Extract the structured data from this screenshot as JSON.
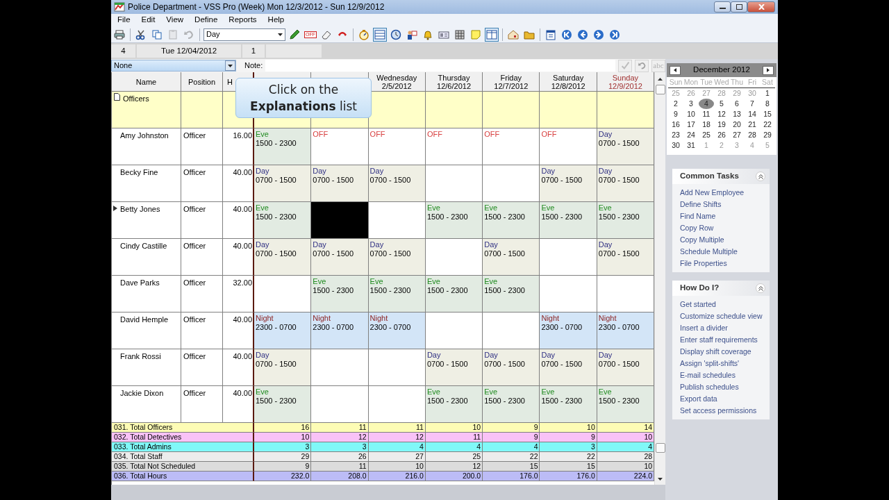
{
  "window": {
    "title": "Police Department - VSS Pro (Week) Mon 12/3/2012 - Sun 12/9/2012"
  },
  "menu": [
    "File",
    "Edit",
    "View",
    "Define",
    "Reports",
    "Help"
  ],
  "toolbar": [
    {
      "kind": "printer",
      "active": false,
      "disabled": false
    },
    {
      "kind": "separator"
    },
    {
      "kind": "scissors",
      "active": false,
      "disabled": false
    },
    {
      "kind": "copy",
      "active": false,
      "disabled": false
    },
    {
      "kind": "paste",
      "active": false,
      "disabled": true
    },
    {
      "kind": "undo",
      "active": false,
      "disabled": true
    },
    {
      "kind": "separator"
    },
    {
      "kind": "select",
      "value": "Day"
    },
    {
      "kind": "pencil",
      "active": false,
      "disabled": false
    },
    {
      "kind": "off",
      "label": "OFF",
      "active": false,
      "disabled": false
    },
    {
      "kind": "eraser",
      "active": false,
      "disabled": false
    },
    {
      "kind": "phone",
      "active": false,
      "disabled": false
    },
    {
      "kind": "separator"
    },
    {
      "kind": "stopwatch",
      "active": false,
      "disabled": false
    },
    {
      "kind": "rows",
      "active": true,
      "disabled": false
    },
    {
      "kind": "clock",
      "active": false,
      "disabled": false
    },
    {
      "kind": "people",
      "active": false,
      "disabled": false
    },
    {
      "kind": "bell",
      "active": false,
      "disabled": false
    },
    {
      "kind": "card",
      "active": false,
      "disabled": false
    },
    {
      "kind": "grid",
      "active": false,
      "disabled": false
    },
    {
      "kind": "note",
      "active": false,
      "disabled": false
    },
    {
      "kind": "panes",
      "active": true,
      "disabled": false
    },
    {
      "kind": "separator"
    },
    {
      "kind": "house",
      "active": false,
      "disabled": false
    },
    {
      "kind": "folder",
      "active": false,
      "disabled": false
    },
    {
      "kind": "separator"
    },
    {
      "kind": "calendar",
      "active": false,
      "disabled": false
    },
    {
      "kind": "first",
      "active": false,
      "disabled": false
    },
    {
      "kind": "prev",
      "active": false,
      "disabled": false
    },
    {
      "kind": "next",
      "active": false,
      "disabled": false
    },
    {
      "kind": "last",
      "active": false,
      "disabled": false
    }
  ],
  "status_row": [
    "4",
    "Tue 12/04/2012",
    "1"
  ],
  "explanations": {
    "value": "None",
    "note_label": "Note:",
    "buttons": [
      {
        "kind": "check",
        "disabled": true
      },
      {
        "kind": "undo",
        "disabled": true
      },
      {
        "kind": "spell",
        "label": "abc",
        "disabled": true
      }
    ]
  },
  "grid": {
    "columns": [
      "Name",
      "Position",
      "H"
    ],
    "day_columns": [
      {
        "day": "Wednesday",
        "date": "2/5/2012",
        "weekend": false
      },
      {
        "day": "Thursday",
        "date": "12/6/2012",
        "weekend": false
      },
      {
        "day": "Friday",
        "date": "12/7/2012",
        "weekend": false
      },
      {
        "day": "Saturday",
        "date": "12/8/2012",
        "weekend": false
      },
      {
        "day": "Sunday",
        "date": "12/9/2012",
        "weekend": true
      }
    ],
    "group": "Officers",
    "rows": [
      {
        "name": "Amy Johnston",
        "position": "Officer",
        "hours": "16.00",
        "current": false,
        "cells": [
          {
            "kind": "eve",
            "shift": "Eve",
            "time": "1500 - 2300"
          },
          {
            "kind": "off",
            "shift": "OFF"
          },
          {
            "kind": "off",
            "shift": "OFF"
          },
          {
            "kind": "off",
            "shift": "OFF"
          },
          {
            "kind": "off",
            "shift": "OFF"
          },
          {
            "kind": "off",
            "shift": "OFF"
          },
          {
            "kind": "day",
            "shift": "Day",
            "time": "0700 - 1500"
          }
        ]
      },
      {
        "name": "Becky Fine",
        "position": "Officer",
        "hours": "40.00",
        "current": false,
        "cells": [
          {
            "kind": "day",
            "shift": "Day",
            "time": "0700 - 1500"
          },
          {
            "kind": "day",
            "shift": "Day",
            "time": "0700 - 1500"
          },
          {
            "kind": "day",
            "shift": "Day",
            "time": "0700 - 1500"
          },
          {
            "kind": "empty"
          },
          {
            "kind": "empty"
          },
          {
            "kind": "day",
            "shift": "Day",
            "time": "0700 - 1500"
          },
          {
            "kind": "day",
            "shift": "Day",
            "time": "0700 - 1500"
          }
        ]
      },
      {
        "name": "Betty Jones",
        "position": "Officer",
        "hours": "40.00",
        "current": true,
        "cells": [
          {
            "kind": "eve",
            "shift": "Eve",
            "time": "1500 - 2300"
          },
          {
            "kind": "blackout"
          },
          {
            "kind": "empty"
          },
          {
            "kind": "eve",
            "shift": "Eve",
            "time": "1500 - 2300"
          },
          {
            "kind": "eve",
            "shift": "Eve",
            "time": "1500 - 2300"
          },
          {
            "kind": "eve",
            "shift": "Eve",
            "time": "1500 - 2300"
          },
          {
            "kind": "eve",
            "shift": "Eve",
            "time": "1500 - 2300"
          }
        ]
      },
      {
        "name": "Cindy Castille",
        "position": "Officer",
        "hours": "40.00",
        "current": false,
        "cells": [
          {
            "kind": "day",
            "shift": "Day",
            "time": "0700 - 1500"
          },
          {
            "kind": "day",
            "shift": "Day",
            "time": "0700 - 1500"
          },
          {
            "kind": "day",
            "shift": "Day",
            "time": "0700 - 1500"
          },
          {
            "kind": "empty"
          },
          {
            "kind": "day",
            "shift": "Day",
            "time": "0700 - 1500"
          },
          {
            "kind": "empty"
          },
          {
            "kind": "day",
            "shift": "Day",
            "time": "0700 - 1500"
          }
        ]
      },
      {
        "name": "Dave Parks",
        "position": "Officer",
        "hours": "32.00",
        "current": false,
        "cells": [
          {
            "kind": "empty"
          },
          {
            "kind": "eve",
            "shift": "Eve",
            "time": "1500 - 2300"
          },
          {
            "kind": "eve",
            "shift": "Eve",
            "time": "1500 - 2300"
          },
          {
            "kind": "eve",
            "shift": "Eve",
            "time": "1500 - 2300"
          },
          {
            "kind": "eve",
            "shift": "Eve",
            "time": "1500 - 2300"
          },
          {
            "kind": "empty"
          },
          {
            "kind": "empty"
          }
        ]
      },
      {
        "name": "David Hemple",
        "position": "Officer",
        "hours": "40.00",
        "current": false,
        "cells": [
          {
            "kind": "night",
            "shift": "Night",
            "time": "2300 - 0700"
          },
          {
            "kind": "night",
            "shift": "Night",
            "time": "2300 - 0700"
          },
          {
            "kind": "night",
            "shift": "Night",
            "time": "2300 - 0700"
          },
          {
            "kind": "empty"
          },
          {
            "kind": "empty"
          },
          {
            "kind": "night",
            "shift": "Night",
            "time": "2300 - 0700"
          },
          {
            "kind": "night",
            "shift": "Night",
            "time": "2300 - 0700"
          }
        ]
      },
      {
        "name": "Frank Rossi",
        "position": "Officer",
        "hours": "40.00",
        "current": false,
        "cells": [
          {
            "kind": "day",
            "shift": "Day",
            "time": "0700 - 1500"
          },
          {
            "kind": "empty"
          },
          {
            "kind": "empty"
          },
          {
            "kind": "day",
            "shift": "Day",
            "time": "0700 - 1500"
          },
          {
            "kind": "day",
            "shift": "Day",
            "time": "0700 - 1500"
          },
          {
            "kind": "day",
            "shift": "Day",
            "time": "0700 - 1500"
          },
          {
            "kind": "day",
            "shift": "Day",
            "time": "0700 - 1500"
          }
        ]
      },
      {
        "name": "Jackie Dixon",
        "position": "Officer",
        "hours": "40.00",
        "current": false,
        "cells": [
          {
            "kind": "eve",
            "shift": "Eve",
            "time": "1500 - 2300"
          },
          {
            "kind": "empty"
          },
          {
            "kind": "empty"
          },
          {
            "kind": "eve",
            "shift": "Eve",
            "time": "1500 - 2300"
          },
          {
            "kind": "eve",
            "shift": "Eve",
            "time": "1500 - 2300"
          },
          {
            "kind": "eve",
            "shift": "Eve",
            "time": "1500 - 2300"
          },
          {
            "kind": "eve",
            "shift": "Eve",
            "time": "1500 - 2300"
          }
        ]
      }
    ],
    "totals": [
      {
        "label": "031. Total Officers",
        "color": "#fdfcb5",
        "values": [
          "16",
          "11",
          "11",
          "10",
          "9",
          "10",
          "14"
        ]
      },
      {
        "label": "032. Total Detectives",
        "color": "#f9c2f7",
        "values": [
          "10",
          "12",
          "12",
          "11",
          "9",
          "9",
          "10"
        ]
      },
      {
        "label": "033. Total Admins",
        "color": "#80f8f8",
        "values": [
          "3",
          "3",
          "4",
          "4",
          "4",
          "3",
          "4"
        ]
      },
      {
        "label": "034. Total Staff",
        "color": "#ececec",
        "values": [
          "29",
          "26",
          "27",
          "25",
          "22",
          "22",
          "28"
        ]
      },
      {
        "label": "035. Total  Not Scheduled",
        "color": "#dcdcdc",
        "values": [
          "9",
          "11",
          "10",
          "12",
          "15",
          "15",
          "10"
        ]
      },
      {
        "label": "036. Total Hours",
        "color": "#bcbcf6",
        "values": [
          "232.0",
          "208.0",
          "216.0",
          "200.0",
          "176.0",
          "176.0",
          "224.0"
        ]
      }
    ]
  },
  "tooltip": [
    "Click on the",
    "**Explanations** list"
  ],
  "calendar": {
    "month": "December 2012",
    "weekdays": [
      "Sun",
      "Mon",
      "Tue",
      "Wed",
      "Thu",
      "Fri",
      "Sat"
    ],
    "weeks": [
      [
        {
          "d": "25",
          "other": true,
          "selected": false
        },
        {
          "d": "26",
          "other": true,
          "selected": false
        },
        {
          "d": "27",
          "other": true,
          "selected": false
        },
        {
          "d": "28",
          "other": true,
          "selected": false
        },
        {
          "d": "29",
          "other": true,
          "selected": false
        },
        {
          "d": "30",
          "other": true,
          "selected": false
        },
        {
          "d": "1",
          "other": false,
          "selected": false
        }
      ],
      [
        {
          "d": "2",
          "other": false,
          "selected": false
        },
        {
          "d": "3",
          "other": false,
          "selected": false
        },
        {
          "d": "4",
          "other": false,
          "selected": true
        },
        {
          "d": "5",
          "other": false,
          "selected": false
        },
        {
          "d": "6",
          "other": false,
          "selected": false
        },
        {
          "d": "7",
          "other": false,
          "selected": false
        },
        {
          "d": "8",
          "other": false,
          "selected": false
        }
      ],
      [
        {
          "d": "9",
          "other": false,
          "selected": false
        },
        {
          "d": "10",
          "other": false,
          "selected": false
        },
        {
          "d": "11",
          "other": false,
          "selected": false
        },
        {
          "d": "12",
          "other": false,
          "selected": false
        },
        {
          "d": "13",
          "other": false,
          "selected": false
        },
        {
          "d": "14",
          "other": false,
          "selected": false
        },
        {
          "d": "15",
          "other": false,
          "selected": false
        }
      ],
      [
        {
          "d": "16",
          "other": false,
          "selected": false
        },
        {
          "d": "17",
          "other": false,
          "selected": false
        },
        {
          "d": "18",
          "other": false,
          "selected": false
        },
        {
          "d": "19",
          "other": false,
          "selected": false
        },
        {
          "d": "20",
          "other": false,
          "selected": false
        },
        {
          "d": "21",
          "other": false,
          "selected": false
        },
        {
          "d": "22",
          "other": false,
          "selected": false
        }
      ],
      [
        {
          "d": "23",
          "other": false,
          "selected": false
        },
        {
          "d": "24",
          "other": false,
          "selected": false
        },
        {
          "d": "25",
          "other": false,
          "selected": false
        },
        {
          "d": "26",
          "other": false,
          "selected": false
        },
        {
          "d": "27",
          "other": false,
          "selected": false
        },
        {
          "d": "28",
          "other": false,
          "selected": false
        },
        {
          "d": "29",
          "other": false,
          "selected": false
        }
      ],
      [
        {
          "d": "30",
          "other": false,
          "selected": false
        },
        {
          "d": "31",
          "other": false,
          "selected": false
        },
        {
          "d": "1",
          "other": true,
          "selected": false
        },
        {
          "d": "2",
          "other": true,
          "selected": false
        },
        {
          "d": "3",
          "other": true,
          "selected": false
        },
        {
          "d": "4",
          "other": true,
          "selected": false
        },
        {
          "d": "5",
          "other": true,
          "selected": false
        }
      ]
    ]
  },
  "panes": [
    {
      "title": "Common Tasks",
      "expanded": true,
      "items": [
        "Add New Employee",
        "Define Shifts",
        "Find Name",
        "Copy Row",
        "Copy Multiple",
        "Schedule Multiple",
        "File Properties"
      ]
    },
    {
      "title": "How Do I?",
      "expanded": true,
      "items": [
        "Get started",
        "Customize schedule view",
        "Insert a divider",
        "Enter staff requirements",
        "Display shift coverage",
        "Assign 'split-shifts'",
        "E-mail schedules",
        "Publish schedules",
        "Export data",
        "Set access permissions"
      ]
    }
  ]
}
